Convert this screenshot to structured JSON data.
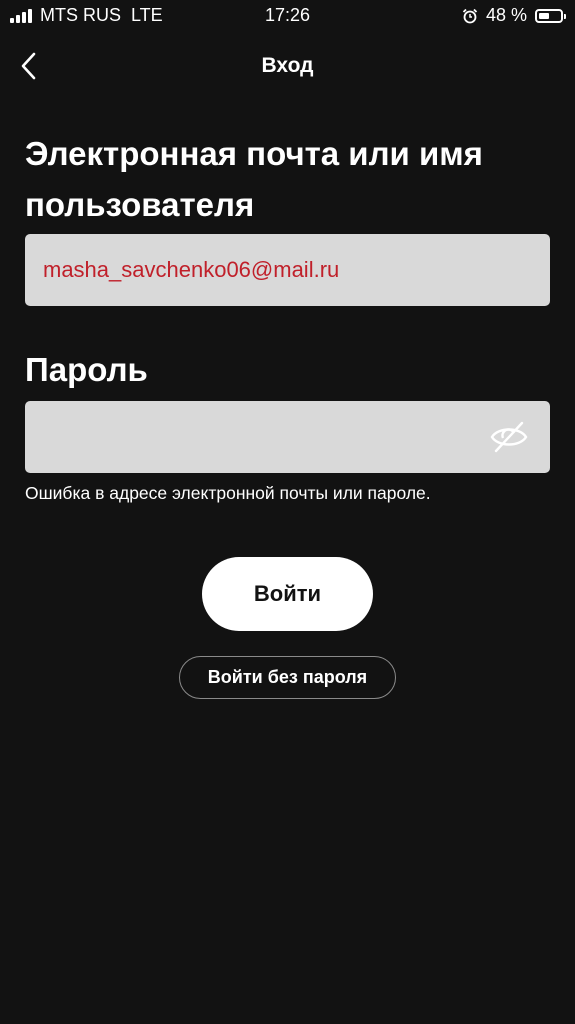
{
  "status_bar": {
    "carrier": "MTS RUS",
    "network": "LTE",
    "time": "17:26",
    "battery_text": "48 %",
    "battery_level": 0.48
  },
  "header": {
    "title": "Вход",
    "back_icon": "chevron-left-icon"
  },
  "form": {
    "email_label": "Электронная почта или имя пользователя",
    "email_value": "masha_savchenko06@mail.ru",
    "password_label": "Пароль",
    "password_value": "",
    "password_toggle_icon": "eye-off-icon",
    "error_message": "Ошибка в адресе электронной почты или пароле."
  },
  "actions": {
    "login_label": "Войти",
    "passwordless_label": "Войти без пароля"
  },
  "colors": {
    "background": "#121212",
    "field_background": "#d9d9d9",
    "email_text": "#c0202a",
    "primary_button": "#ffffff"
  }
}
